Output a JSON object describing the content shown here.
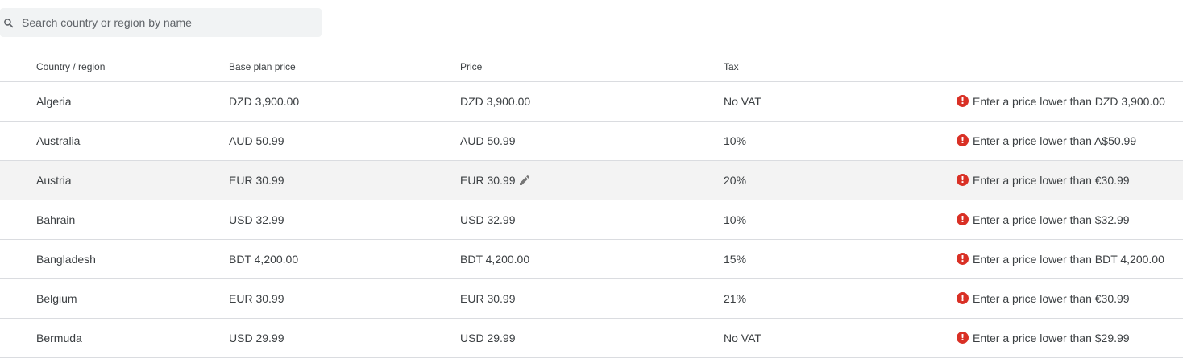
{
  "search": {
    "placeholder": "Search country or region by name"
  },
  "table": {
    "headers": {
      "country": "Country / region",
      "base_price": "Base plan price",
      "price": "Price",
      "tax": "Tax"
    },
    "rows": [
      {
        "country": "Algeria",
        "base_price": "DZD 3,900.00",
        "price": "DZD 3,900.00",
        "tax": "No VAT",
        "message": "Enter a price lower than DZD 3,900.00"
      },
      {
        "country": "Australia",
        "base_price": "AUD 50.99",
        "price": "AUD 50.99",
        "tax": "10%",
        "message": "Enter a price lower than A$50.99"
      },
      {
        "country": "Austria",
        "base_price": "EUR 30.99",
        "price": "EUR 30.99",
        "tax": "20%",
        "message": "Enter a price lower than €30.99"
      },
      {
        "country": "Bahrain",
        "base_price": "USD 32.99",
        "price": "USD 32.99",
        "tax": "10%",
        "message": "Enter a price lower than $32.99"
      },
      {
        "country": "Bangladesh",
        "base_price": "BDT 4,200.00",
        "price": "BDT 4,200.00",
        "tax": "15%",
        "message": "Enter a price lower than BDT 4,200.00"
      },
      {
        "country": "Belgium",
        "base_price": "EUR 30.99",
        "price": "EUR 30.99",
        "tax": "21%",
        "message": "Enter a price lower than €30.99"
      },
      {
        "country": "Bermuda",
        "base_price": "USD 29.99",
        "price": "USD 29.99",
        "tax": "No VAT",
        "message": "Enter a price lower than $29.99"
      }
    ],
    "highlighted_row": "Austria",
    "error_icon_glyph": "!"
  },
  "icons": {
    "search": "search-icon",
    "edit": "edit-pencil-icon",
    "error": "error-icon"
  },
  "colors": {
    "error": "#d93025",
    "search_bg": "#f1f3f4",
    "row_hover": "#f3f3f3",
    "divider": "#dadce0"
  }
}
